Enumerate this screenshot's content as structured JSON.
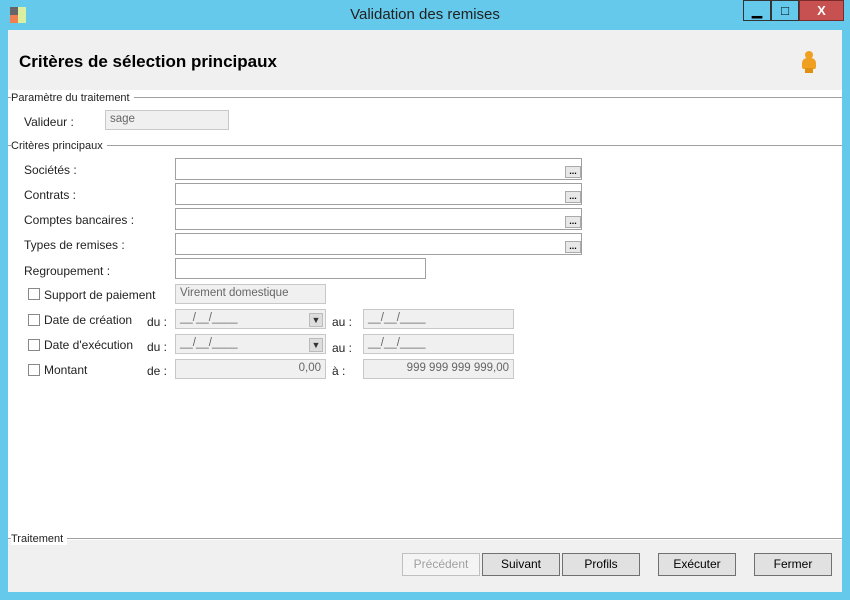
{
  "window": {
    "title": "Validation des remises",
    "minimize": "▁",
    "maximize": "□",
    "close": "X"
  },
  "header": {
    "title": "Critères de sélection principaux",
    "icon": "user-icon"
  },
  "param": {
    "group": "Paramètre du traitement",
    "validator_label": "Valideur :",
    "validator_value": "sage"
  },
  "criteria": {
    "group": "Critères principaux",
    "societes": "Sociétés :",
    "contrats": "Contrats :",
    "comptes": "Comptes bancaires :",
    "types": "Types de remises :",
    "regroupement": "Regroupement :",
    "ellipsis": "...",
    "support_label": "Support de paiement",
    "support_value": "Virement domestique",
    "creation_label": "Date de création",
    "execution_label": "Date d'exécution",
    "montant_label": "Montant",
    "du": "du :",
    "au": "au :",
    "de": "de :",
    "a": "à :",
    "date_mask": "__/__/____",
    "montant_from": "0,00",
    "montant_to": "999 999 999 999,00"
  },
  "footer": {
    "group": "Traitement",
    "prev": "Précédent",
    "next": "Suivant",
    "profiles": "Profils",
    "execute": "Exécuter",
    "close": "Fermer"
  }
}
